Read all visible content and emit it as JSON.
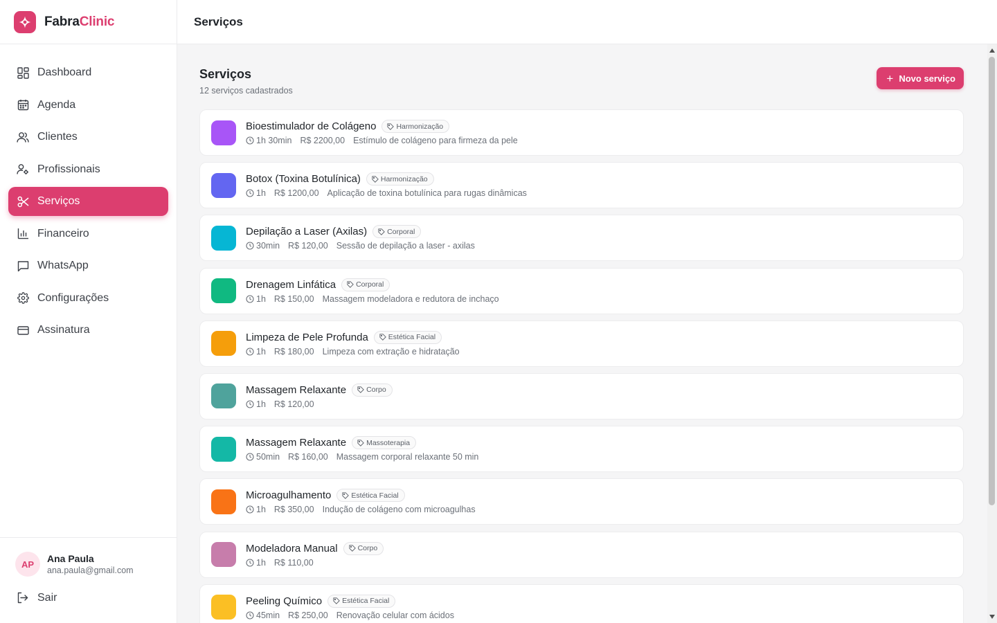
{
  "brand": {
    "name_part1": "Fabra",
    "name_part2": "Clinic"
  },
  "topbar": {
    "title": "Serviços"
  },
  "sidebar": {
    "items": [
      {
        "label": "Dashboard",
        "icon": "dashboard-icon"
      },
      {
        "label": "Agenda",
        "icon": "calendar-icon"
      },
      {
        "label": "Clientes",
        "icon": "users-icon"
      },
      {
        "label": "Profissionais",
        "icon": "user-cog-icon"
      },
      {
        "label": "Serviços",
        "icon": "scissors-icon",
        "active": true
      },
      {
        "label": "Financeiro",
        "icon": "bar-chart-icon"
      },
      {
        "label": "WhatsApp",
        "icon": "message-icon"
      },
      {
        "label": "Configurações",
        "icon": "gear-icon"
      },
      {
        "label": "Assinatura",
        "icon": "credit-card-icon"
      }
    ]
  },
  "user": {
    "initials": "AP",
    "name": "Ana Paula",
    "email": "ana.paula@gmail.com",
    "logout_label": "Sair"
  },
  "page": {
    "title": "Serviços",
    "subtitle": "12 serviços cadastrados",
    "new_button": "Novo serviço"
  },
  "colors": {
    "accent": "#dc3e6f"
  },
  "services": [
    {
      "name": "Bioestimulador de Colágeno",
      "tag": "Harmonização",
      "duration": "1h 30min",
      "price": "R$ 2200,00",
      "description": "Estímulo de colágeno para firmeza da pele",
      "color": "#a855f7"
    },
    {
      "name": "Botox (Toxina Botulínica)",
      "tag": "Harmonização",
      "duration": "1h",
      "price": "R$ 1200,00",
      "description": "Aplicação de toxina botulínica para rugas dinâmicas",
      "color": "#6366f1"
    },
    {
      "name": "Depilação a Laser (Axilas)",
      "tag": "Corporal",
      "duration": "30min",
      "price": "R$ 120,00",
      "description": "Sessão de depilação a laser - axilas",
      "color": "#06b6d4"
    },
    {
      "name": "Drenagem Linfática",
      "tag": "Corporal",
      "duration": "1h",
      "price": "R$ 150,00",
      "description": "Massagem modeladora e redutora de inchaço",
      "color": "#10b981"
    },
    {
      "name": "Limpeza de Pele Profunda",
      "tag": "Estética Facial",
      "duration": "1h",
      "price": "R$ 180,00",
      "description": "Limpeza com extração e hidratação",
      "color": "#f59e0b"
    },
    {
      "name": "Massagem Relaxante",
      "tag": "Corpo",
      "duration": "1h",
      "price": "R$ 120,00",
      "description": "",
      "color": "#4fa39c"
    },
    {
      "name": "Massagem Relaxante",
      "tag": "Massoterapia",
      "duration": "50min",
      "price": "R$ 160,00",
      "description": "Massagem corporal relaxante 50 min",
      "color": "#14b8a6"
    },
    {
      "name": "Microagulhamento",
      "tag": "Estética Facial",
      "duration": "1h",
      "price": "R$ 350,00",
      "description": "Indução de colágeno com microagulhas",
      "color": "#f97316"
    },
    {
      "name": "Modeladora Manual",
      "tag": "Corpo",
      "duration": "1h",
      "price": "R$ 110,00",
      "description": "",
      "color": "#c77dab"
    },
    {
      "name": "Peeling Químico",
      "tag": "Estética Facial",
      "duration": "45min",
      "price": "R$ 250,00",
      "description": "Renovação celular com ácidos",
      "color": "#fbbf24"
    }
  ]
}
